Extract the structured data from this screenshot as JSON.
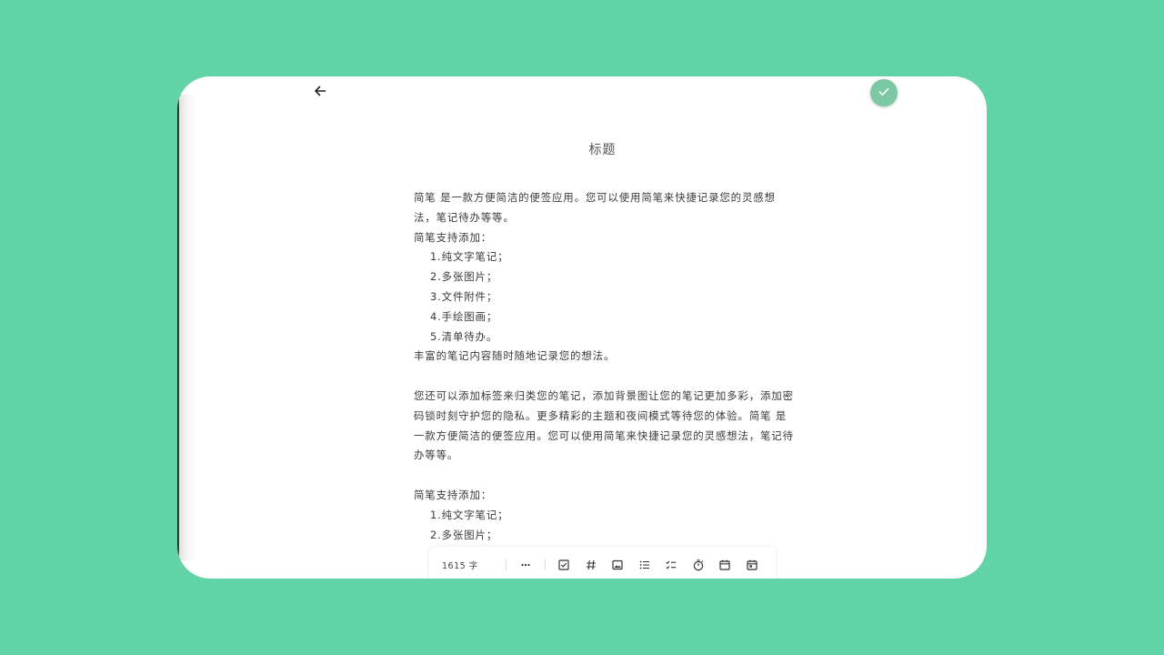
{
  "header": {
    "back_icon": "arrow-left-icon",
    "done_icon": "check-icon",
    "accent_color": "#7cc8a2"
  },
  "note": {
    "title": "标题",
    "lines": [
      "简笔 是一款方便简洁的便签应用。您可以使用简笔来快捷记录您的灵感想",
      "法，笔记待办等等。",
      "简笔支持添加：",
      "1.纯文字笔记；",
      "2.多张图片；",
      "3.文件附件；",
      "4.手绘图画；",
      "5.清单待办。",
      "丰富的笔记内容随时随地记录您的想法。",
      "",
      "您还可以添加标签来归类您的笔记，添加背景图让您的笔记更加多彩，添加密",
      "码锁时刻守护您的隐私。更多精彩的主题和夜间模式等待您的体验。简笔 是",
      "一款方便简洁的便签应用。您可以使用简笔来快捷记录您的灵感想法，笔记待",
      "办等等。",
      "",
      "简笔支持添加：",
      "1.纯文字笔记；",
      "2.多张图片；"
    ]
  },
  "toolbar": {
    "word_count": "1615 字",
    "more_icon": "more-dots-icon",
    "tools": [
      "checkbox-icon",
      "hashtag-icon",
      "image-icon",
      "bullet-list-icon",
      "checklist-icon",
      "timer-icon",
      "calendar-icon",
      "calendar-date-icon"
    ]
  },
  "colors": {
    "background": "#62d3a4",
    "card": "#ffffff",
    "text": "#3a3a3a"
  }
}
